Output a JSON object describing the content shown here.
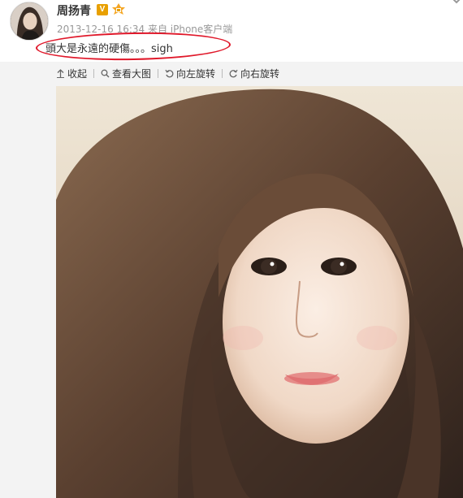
{
  "post": {
    "username": "周扬青",
    "verified_badge": "V",
    "timestamp": "2013-12-16 16:34 来自 iPhone客户端",
    "text": "頭大是永遠的硬傷。。。sigh"
  },
  "toolbar": {
    "collapse": "收起",
    "view_large": "查看大图",
    "rotate_left": "向左旋转",
    "rotate_right": "向右旋转"
  },
  "icons": {
    "collapse": "arrow-up-icon",
    "view_large": "magnifier-icon",
    "rotate_left": "rotate-left-icon",
    "rotate_right": "rotate-right-icon",
    "more": "chevron-down-icon",
    "level": "level-badge-icon"
  },
  "colors": {
    "highlight_ellipse": "#e0182a",
    "verified": "#e8a000",
    "meta_text": "#999999"
  }
}
